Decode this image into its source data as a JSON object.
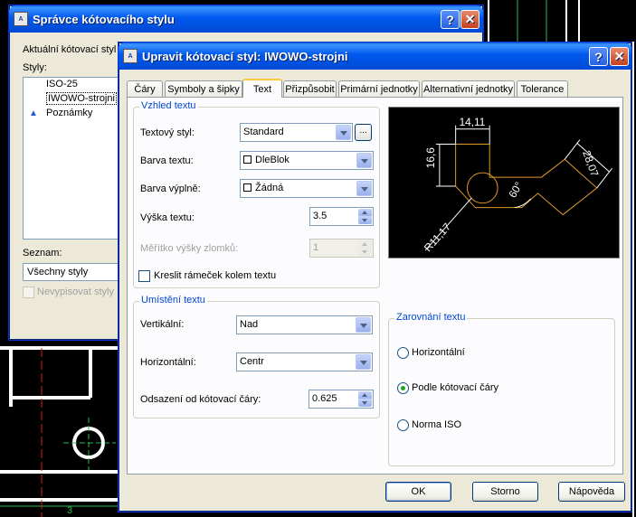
{
  "cad_bg": {
    "label_3": "3"
  },
  "back_dialog": {
    "title": "Správce kótovacího stylu",
    "current_style_label": "Aktuální kótovací styl",
    "styles_label": "Styly:",
    "styles": [
      {
        "name": "ISO-25",
        "annotative": false
      },
      {
        "name": "IWOWO-strojni",
        "annotative": false,
        "selected": true
      },
      {
        "name": "Poznámky",
        "annotative": true
      }
    ],
    "list_label": "Seznam:",
    "list_value": "Všechny styly",
    "dont_list_label": "Nevypisovat styly X"
  },
  "dialog": {
    "title": "Upravit kótovací styl: IWOWO-strojni",
    "help_glyph": "?",
    "close_glyph": "✕",
    "tabs": [
      "Čáry",
      "Symboly a šipky",
      "Text",
      "Přizpůsobit",
      "Primární jednotky",
      "Alternativní jednotky",
      "Tolerance"
    ],
    "active_tab": "Text",
    "text_appearance": {
      "title": "Vzhled textu",
      "text_style_label": "Textový styl:",
      "text_style_value": "Standard",
      "browse_label": "...",
      "text_color_label": "Barva textu:",
      "text_color_value": "DleBlok",
      "fill_color_label": "Barva výplně:",
      "fill_color_value": "Žádná",
      "text_height_label": "Výška textu:",
      "text_height_value": "3.5",
      "fraction_scale_label": "Měřítko výšky zlomků:",
      "fraction_scale_value": "1",
      "frame_label": "Kreslit rámeček kolem textu"
    },
    "text_placement": {
      "title": "Umístění textu",
      "vertical_label": "Vertikální:",
      "vertical_value": "Nad",
      "horizontal_label": "Horizontální:",
      "horizontal_value": "Centr",
      "offset_label": "Odsazení od kótovací čáry:",
      "offset_value": "0.625"
    },
    "text_alignment": {
      "title": "Zarovnání textu",
      "options": [
        "Horizontální",
        "Podle kótovací čáry",
        "Norma ISO"
      ],
      "selected": "Podle kótovací čáry"
    },
    "preview": {
      "dim_top": "14,11",
      "dim_left": "16,6",
      "dim_right": "28,07",
      "dim_angle": "60°",
      "dim_radius": "R11,17"
    },
    "buttons": {
      "ok": "OK",
      "cancel": "Storno",
      "help": "Nápověda"
    }
  },
  "colors": {
    "preview_geometry": "#e09a2a",
    "preview_dims": "#ffffff",
    "cad_lines": "#ffffff",
    "cad_accent": "#2fb84a"
  }
}
